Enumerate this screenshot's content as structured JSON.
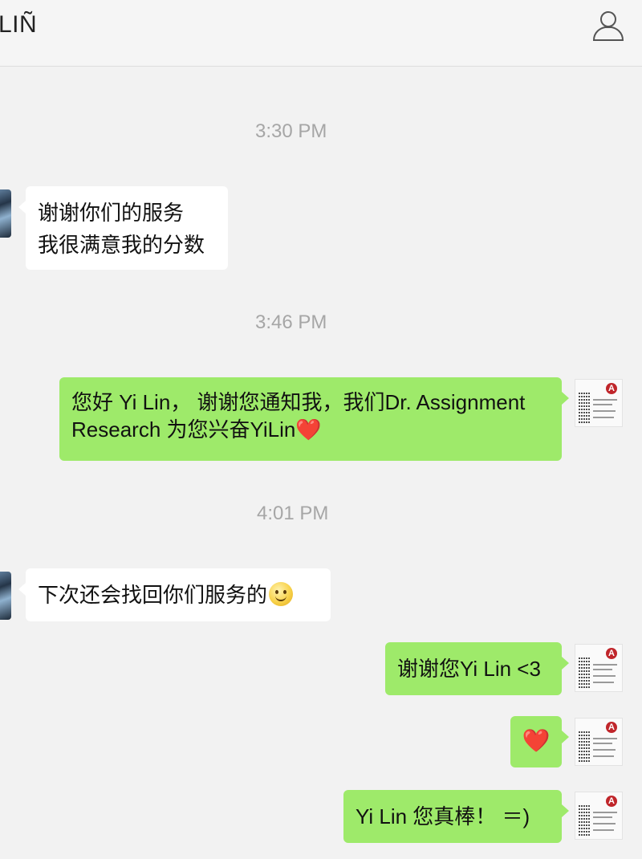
{
  "header": {
    "title": "LIÑ",
    "profile_icon": "person-icon"
  },
  "messages": [
    {
      "type": "timestamp",
      "text": "3:30 PM"
    },
    {
      "type": "incoming",
      "lines": [
        "谢谢你们的服务",
        "我很满意我的分数"
      ]
    },
    {
      "type": "timestamp",
      "text": "3:46 PM"
    },
    {
      "type": "outgoing",
      "lines": [
        "您好 Yi Lin， 谢谢您通知我，我们Dr. Assignment",
        "Research 为您兴奋YiLin"
      ],
      "emoji": "❤️"
    },
    {
      "type": "timestamp",
      "text": "4:01 PM"
    },
    {
      "type": "incoming",
      "text": "下次还会找回你们服务的",
      "emoji": "smile-emoji"
    },
    {
      "type": "outgoing",
      "text": "谢谢您Yi Lin <3"
    },
    {
      "type": "outgoing",
      "text": "",
      "emoji": "❤️"
    },
    {
      "type": "outgoing",
      "text": "Yi Lin 您真棒！ ＝)"
    }
  ],
  "colors": {
    "outgoing_bubble": "#9eea6a",
    "incoming_bubble": "#ffffff",
    "background": "#f2f2f2",
    "timestamp": "#a6a6a6"
  }
}
